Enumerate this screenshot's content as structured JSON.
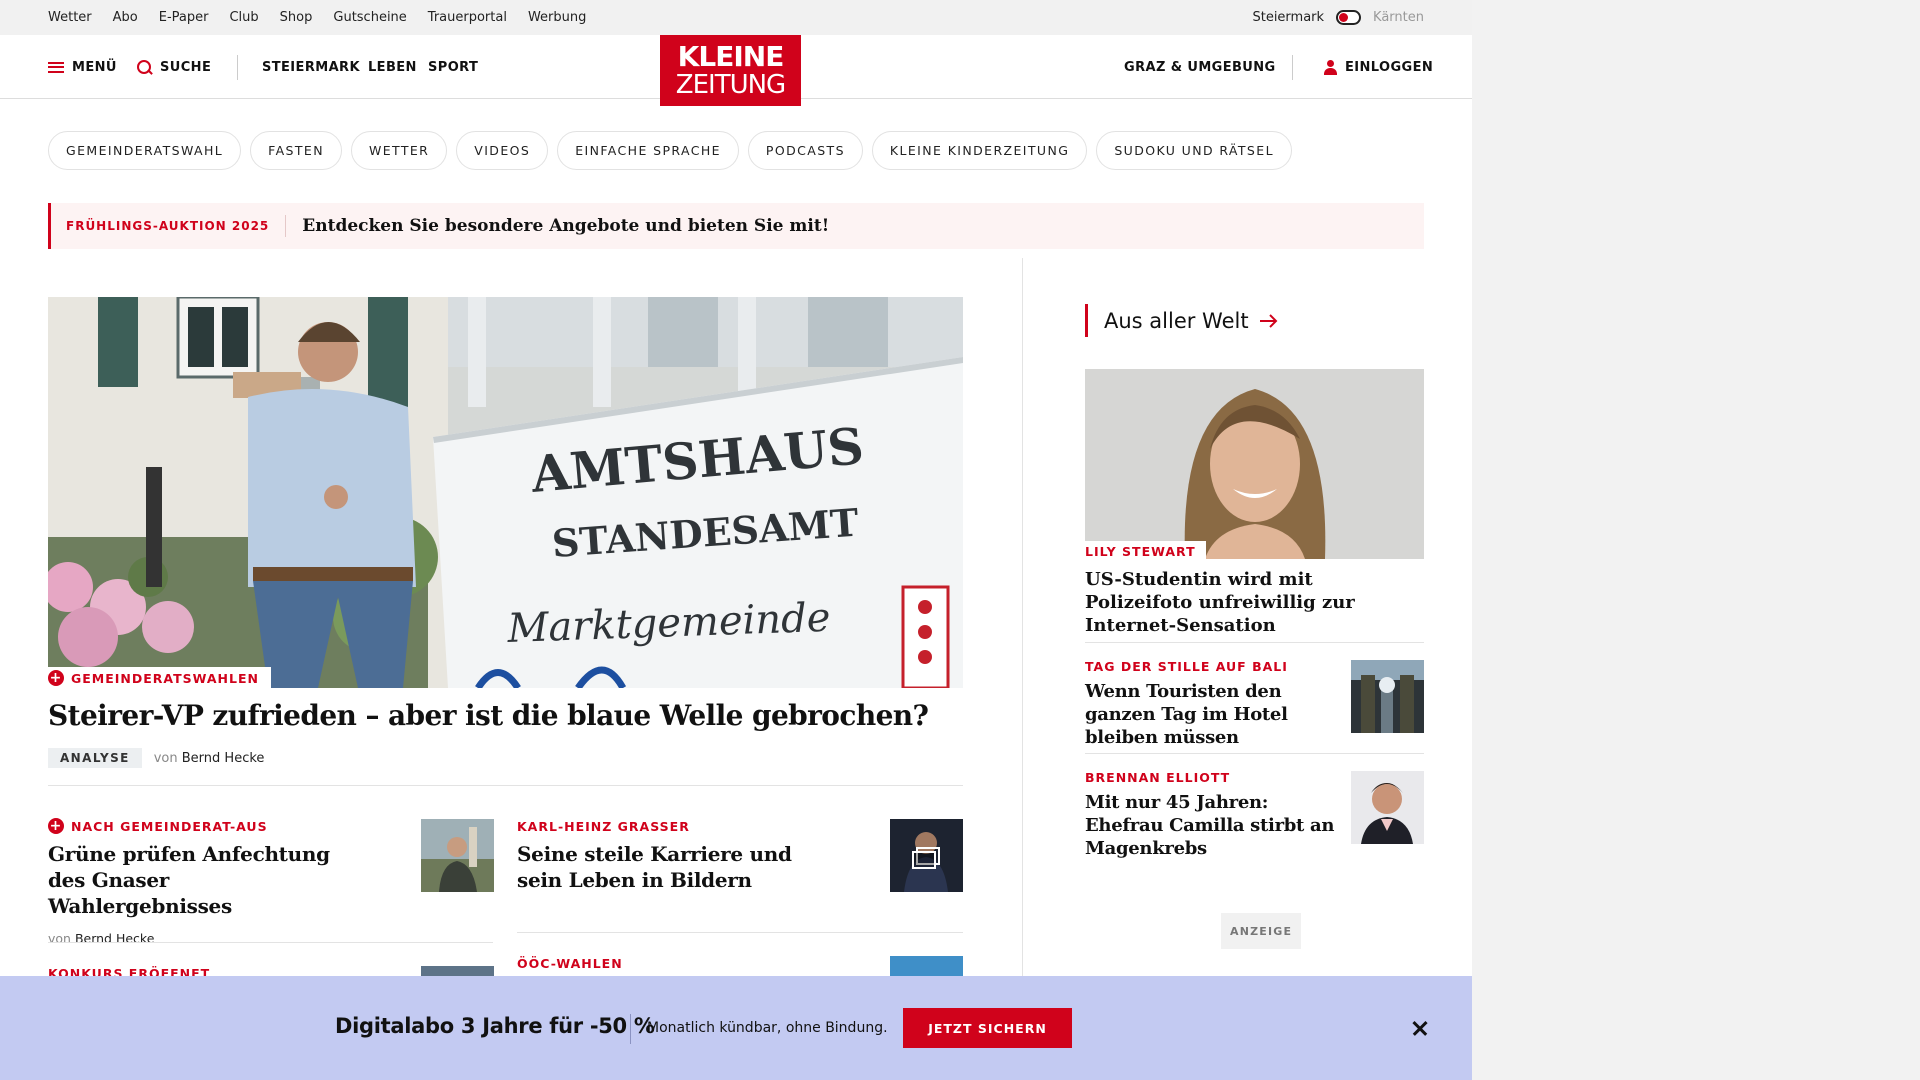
{
  "topbar": {
    "links": [
      "Wetter",
      "Abo",
      "E-Paper",
      "Club",
      "Shop",
      "Gutscheine",
      "Trauerportal",
      "Werbung"
    ],
    "region_active": "Steiermark",
    "region_inactive": "Kärnten"
  },
  "header": {
    "menu_label": "MENÜ",
    "search_label": "SUCHE",
    "nav": [
      "STEIERMARK",
      "LEBEN",
      "SPORT"
    ],
    "logo_line1": "KLEINE",
    "logo_line2": "ZEITUNG",
    "local_label": "GRAZ & UMGEBUNG",
    "login_label": "EINLOGGEN"
  },
  "pills": [
    "GEMEINDERATSWAHL",
    "FASTEN",
    "WETTER",
    "VIDEOS",
    "EINFACHE SPRACHE",
    "PODCASTS",
    "KLEINE KINDERZEITUNG",
    "SUDOKU UND RÄTSEL"
  ],
  "promo": {
    "kicker": "FRÜHLINGS-AUKTION 2025",
    "text": "Entdecken Sie besondere Angebote und bieten Sie mit!"
  },
  "hero": {
    "sign_line1": "AMTSHAUS",
    "sign_line2": "STANDESAMT",
    "sign_line3": "Marktgemeinde",
    "kicker": "GEMEINDERATSWAHLEN",
    "title": "Steirer-VP zufrieden – aber ist die blaue Welle gebrochen?",
    "badge": "ANALYSE",
    "von": "von",
    "author": "Bernd Hecke"
  },
  "teasers": [
    {
      "kicker": "NACH GEMEINDERAT-AUS",
      "title": "Grüne prüfen Anfechtung des Gnaser Wahlergebnisses",
      "von": "von",
      "author": "Bernd Hecke"
    },
    {
      "kicker": "KARL-HEINZ GRASSER",
      "title": "Seine steile Karriere und sein Leben in Bildern"
    },
    {
      "kicker": "KONKURS ERÖFFNET"
    },
    {
      "kicker": "ÖÖC-WAHLEN"
    }
  ],
  "sidebar": {
    "heading": "Aus aller Welt",
    "lead": {
      "kicker": "LILY STEWART",
      "title": "US-Studentin wird mit Polizeifoto unfreiwillig zur Internet-Sensation"
    },
    "items": [
      {
        "kicker": "TAG DER STILLE AUF BALI",
        "title": "Wenn Touristen den ganzen Tag im Hotel bleiben müssen"
      },
      {
        "kicker": "BRENNAN ELLIOTT",
        "title": "Mit nur 45 Jahren: Ehefrau Camilla stirbt an Magenkrebs"
      }
    ],
    "ad_label": "ANZEIGE"
  },
  "banner": {
    "headline": "Digitalabo 3 Jahre für -50 %",
    "subtext": "Monatlich kündbar, ohne Bindung.",
    "cta": "JETZT SICHERN"
  },
  "colors": {
    "brand_red": "#d0021b",
    "banner_bg": "#c3caf2",
    "promo_bg": "#fdf3f3",
    "topbar_bg": "#f1f1f1",
    "gutter_bg": "#f2f2f2"
  }
}
